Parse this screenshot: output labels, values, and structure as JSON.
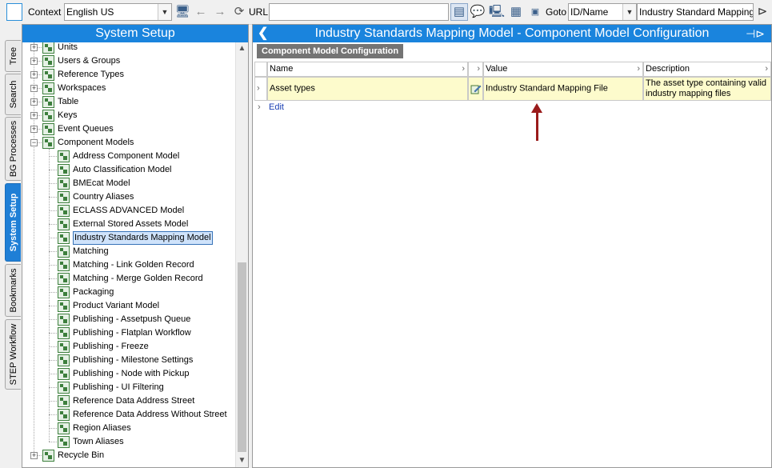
{
  "toolbar": {
    "context_label": "Context",
    "context_value": "English US",
    "url_label": "URL",
    "url_value": "",
    "goto_label": "Goto",
    "goto_type": "ID/Name",
    "goto_value": "Industry Standard Mapping F"
  },
  "vertical_tabs": [
    "Tree",
    "Search",
    "BG Processes",
    "System Setup",
    "Bookmarks",
    "STEP Workflow"
  ],
  "active_tab": "System Setup",
  "left_panel": {
    "title": "System Setup",
    "items": [
      {
        "label": "Units",
        "level": 1,
        "expander": "+"
      },
      {
        "label": "Users & Groups",
        "level": 1,
        "expander": "+"
      },
      {
        "label": "Reference Types",
        "level": 1,
        "expander": "+"
      },
      {
        "label": "Workspaces",
        "level": 1,
        "expander": "+"
      },
      {
        "label": "Table",
        "level": 1,
        "expander": "+"
      },
      {
        "label": "Keys",
        "level": 1,
        "expander": "+"
      },
      {
        "label": "Event Queues",
        "level": 1,
        "expander": "+"
      },
      {
        "label": "Component Models",
        "level": 1,
        "expander": "-"
      },
      {
        "label": "Address Component Model",
        "level": 2
      },
      {
        "label": "Auto Classification Model",
        "level": 2
      },
      {
        "label": "BMEcat Model",
        "level": 2
      },
      {
        "label": "Country Aliases",
        "level": 2
      },
      {
        "label": "ECLASS ADVANCED Model",
        "level": 2
      },
      {
        "label": "External Stored Assets Model",
        "level": 2
      },
      {
        "label": "Industry Standards Mapping Model",
        "level": 2,
        "selected": true
      },
      {
        "label": "Matching",
        "level": 2
      },
      {
        "label": "Matching - Link Golden Record",
        "level": 2
      },
      {
        "label": "Matching - Merge Golden Record",
        "level": 2
      },
      {
        "label": "Packaging",
        "level": 2
      },
      {
        "label": "Product Variant Model",
        "level": 2
      },
      {
        "label": "Publishing - Assetpush Queue",
        "level": 2
      },
      {
        "label": "Publishing - Flatplan Workflow",
        "level": 2
      },
      {
        "label": "Publishing - Freeze",
        "level": 2
      },
      {
        "label": "Publishing - Milestone Settings",
        "level": 2
      },
      {
        "label": "Publishing - Node with Pickup",
        "level": 2
      },
      {
        "label": "Publishing - UI Filtering",
        "level": 2
      },
      {
        "label": "Reference Data Address Street",
        "level": 2
      },
      {
        "label": "Reference Data Address Without Street",
        "level": 2
      },
      {
        "label": "Region Aliases",
        "level": 2
      },
      {
        "label": "Town Aliases",
        "level": 2
      },
      {
        "label": "Recycle Bin",
        "level": 1,
        "expander": "+"
      }
    ]
  },
  "right_panel": {
    "title": "Industry Standards Mapping Model - Component Model Configuration",
    "subtab": "Component Model Configuration",
    "columns": [
      "Name",
      "Value",
      "Description"
    ],
    "rows": [
      {
        "name": "Asset types",
        "value": "Industry Standard Mapping File",
        "description": "The asset type containing valid industry mapping files"
      }
    ],
    "edit_label": "Edit"
  },
  "colors": {
    "header_blue": "#1a84dd",
    "row_yellow": "#fdfbcc",
    "arrow_red": "#9a1b1b"
  }
}
